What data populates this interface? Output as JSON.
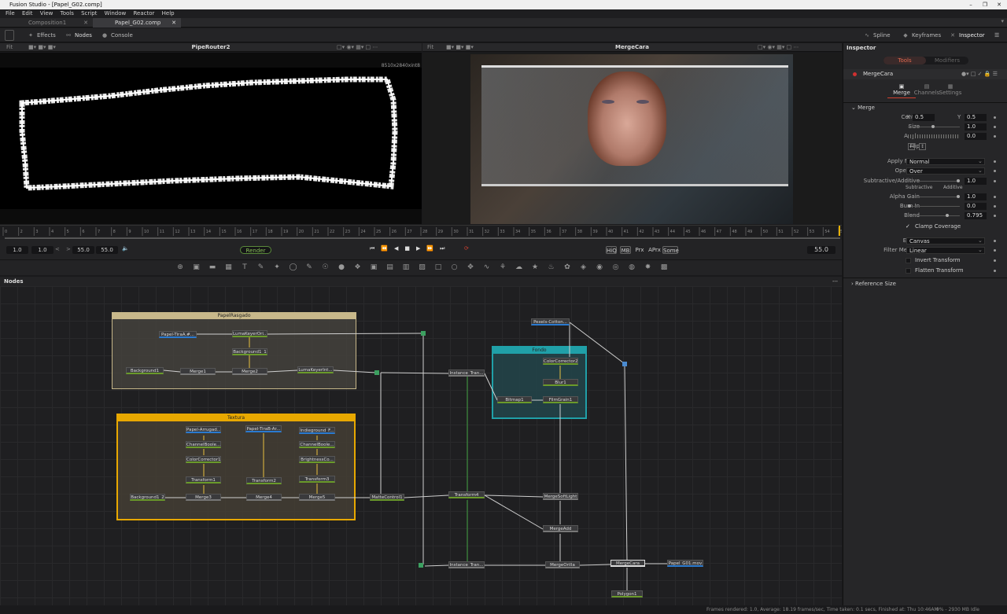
{
  "window": {
    "title": "Fusion Studio - [Papel_G02.comp]"
  },
  "menu": [
    "File",
    "Edit",
    "View",
    "Tools",
    "Script",
    "Window",
    "Reactor",
    "Help"
  ],
  "tabs": [
    {
      "label": "Composition1"
    },
    {
      "label": "Papel_G02.comp"
    }
  ],
  "toolbar": {
    "effects": "Effects",
    "nodes": "Nodes",
    "console": "Console",
    "spline": "Spline",
    "keyframes": "Keyframes",
    "inspector": "Inspector"
  },
  "viewers": {
    "left": {
      "fit": "Fit",
      "name": "PipeRouter2",
      "resolution": "8510x2840xint8"
    },
    "right": {
      "fit": "Fit",
      "name": "MergeCara"
    }
  },
  "ruler": {
    "ticks": [
      "0",
      "2",
      "3",
      "4",
      "5",
      "6",
      "7",
      "8",
      "9",
      "10",
      "11",
      "12",
      "13",
      "14",
      "15",
      "16",
      "17",
      "18",
      "19",
      "20",
      "21",
      "22",
      "23",
      "24",
      "25",
      "26",
      "27",
      "28",
      "29",
      "30",
      "31",
      "32",
      "33",
      "34",
      "35",
      "36",
      "37",
      "38",
      "39",
      "40",
      "41",
      "42",
      "43",
      "44",
      "45",
      "46",
      "47",
      "48",
      "49",
      "50",
      "51",
      "52",
      "53",
      "54",
      "55"
    ]
  },
  "transport": {
    "start": "1.0",
    "render_start": "1.0",
    "render_end": "55.0",
    "end": "55.0",
    "render_label": "Render",
    "hiq": "HiQ",
    "mb": "MB",
    "prx": "Prx",
    "aprx": "APrx",
    "some": "Some",
    "current": "55.0"
  },
  "nodes_panel": {
    "title": "Nodes"
  },
  "groups": {
    "papel": "PapelRasgado",
    "textura": "Textura",
    "fondo": "Fondo"
  },
  "nodes": {
    "papel_tira": "Papel-TiraA.#...",
    "luma1": "LumaKeyerOri...",
    "bg1_1": "Background1_1",
    "bg1": "Background1",
    "merge1": "Merge1",
    "merge2": "Merge2",
    "luma2": "LumaKeyerInt...",
    "pexels": "Pexels-Cotton...",
    "cc2": "ColorCorrector2",
    "blur1": "Blur1",
    "bitmap1": "Bitmap1",
    "filmgrain": "FilmGrain1",
    "inst1": "Instance_Tran...",
    "arrug": "Papel-Arrugad...",
    "cbool1": "ChannelBoole...",
    "cc1": "ColorCorrector1",
    "tf1": "Transform1",
    "tirab": "Papel-TiraB-Ar...",
    "tf2": "Transform2",
    "indie": "Indieground_F...",
    "cbool2": "ChannelBoole...",
    "bright": "BrightnessCo...",
    "tf3": "Transform3",
    "bg12": "Background1_2",
    "merge3": "Merge3",
    "merge4": "Merge4",
    "merge5": "Merge5",
    "matte": "MatteControl1",
    "tf4": "Transform4",
    "softlight": "MergeSoftLight",
    "mergeadd": "MergeAdd",
    "inst2": "Instance_Tran...",
    "orilla": "MergeOrilla",
    "cara": "MergeCara",
    "out": "Papel_G01.mov",
    "poly": "Polygon1"
  },
  "inspector": {
    "title": "Inspector",
    "tab_tools": "Tools",
    "tab_modifiers": "Modifiers",
    "node_name": "MergeCara",
    "subtabs": [
      "Merge",
      "Channels",
      "Settings"
    ],
    "section": "Merge",
    "center_label": "Center",
    "x_label": "X",
    "center_x": "0.5",
    "y_label": "Y",
    "center_y": "0.5",
    "size_label": "Size",
    "size": "1.0",
    "angle_label": "Angle",
    "angle": "0.0",
    "flip_label": "Flip",
    "apply_mode_label": "Apply Mode",
    "apply_mode": "Normal",
    "operator_label": "Operator",
    "operator": "Over",
    "subadd_label": "Subtractive/Additive",
    "subadd": "1.0",
    "subtractive": "Subtractive",
    "additive": "Additive",
    "alpha_gain_label": "Alpha Gain",
    "alpha_gain": "1.0",
    "burn_in_label": "Burn In",
    "burn_in": "0.0",
    "blend_label": "Blend",
    "blend": "0.795",
    "clamp": "Clamp Coverage",
    "edges_label": "Edges",
    "edges": "Canvas",
    "filter_label": "Filter Method",
    "filter": "Linear",
    "invert": "Invert Transform",
    "flatten": "Flatten Transform",
    "reference": "Reference Size"
  },
  "status": {
    "left": "Frames rendered: 1.0,  Average: 18.19 frames/sec,  Time taken: 0.1 secs,  Finished at: Thu 10:46AM",
    "mem": "9% - 2930 MB",
    "state": "Idle"
  }
}
